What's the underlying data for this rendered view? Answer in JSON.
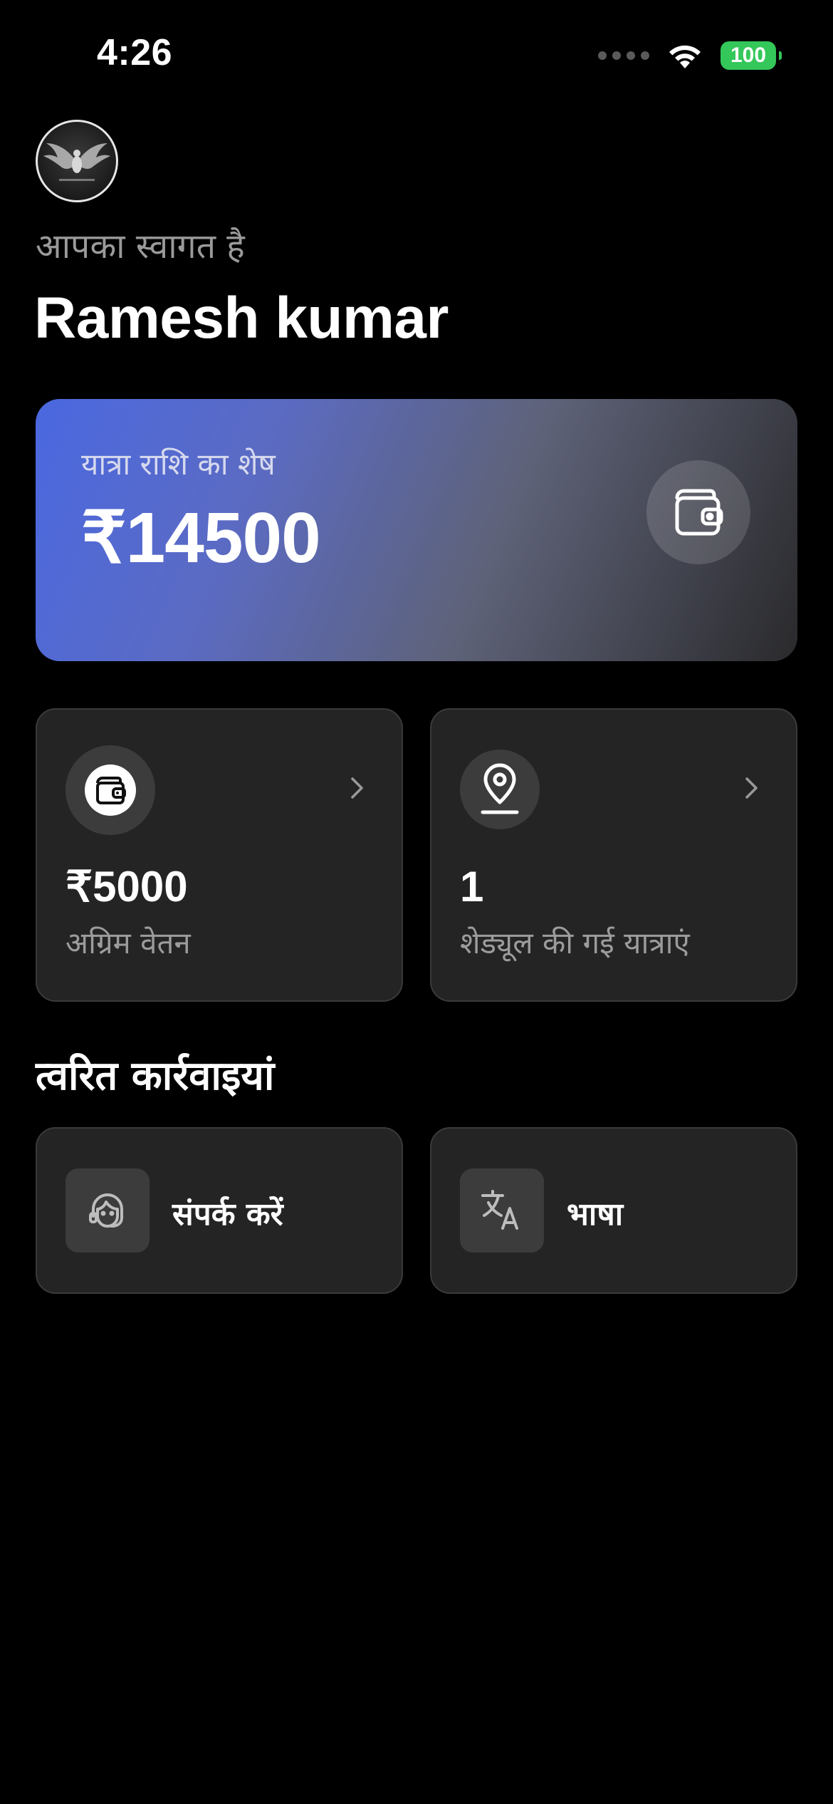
{
  "status_bar": {
    "time": "4:26",
    "battery_level": "100",
    "icons": [
      "signal-dots-icon",
      "wifi-icon",
      "battery-icon"
    ]
  },
  "header": {
    "logo_icon": "eagle-wings-logo",
    "welcome_text": "आपका स्वागत है",
    "user_name": "Ramesh kumar"
  },
  "balance_card": {
    "label": "यात्रा राशि का शेष",
    "value": "₹14500",
    "icon": "wallet-icon",
    "gradient_start": "#4a68e0",
    "gradient_end": "#2a2a2c"
  },
  "stats": [
    {
      "value": "₹5000",
      "label": "अग्रिम वेतन",
      "icon": "wallet-icon"
    },
    {
      "value": "1",
      "label": "शेड्यूल की गई यात्राएं",
      "icon": "location-pin-icon"
    }
  ],
  "quick_actions": {
    "title": "त्वरित कार्रवाइयां",
    "items": [
      {
        "label": "संपर्क करें",
        "icon": "support-agent-icon"
      },
      {
        "label": "भाषा",
        "icon": "translate-icon"
      }
    ]
  },
  "colors": {
    "background": "#000000",
    "card_background": "#242424",
    "battery_green": "#34c759",
    "muted_text": "#9c9c9c"
  }
}
